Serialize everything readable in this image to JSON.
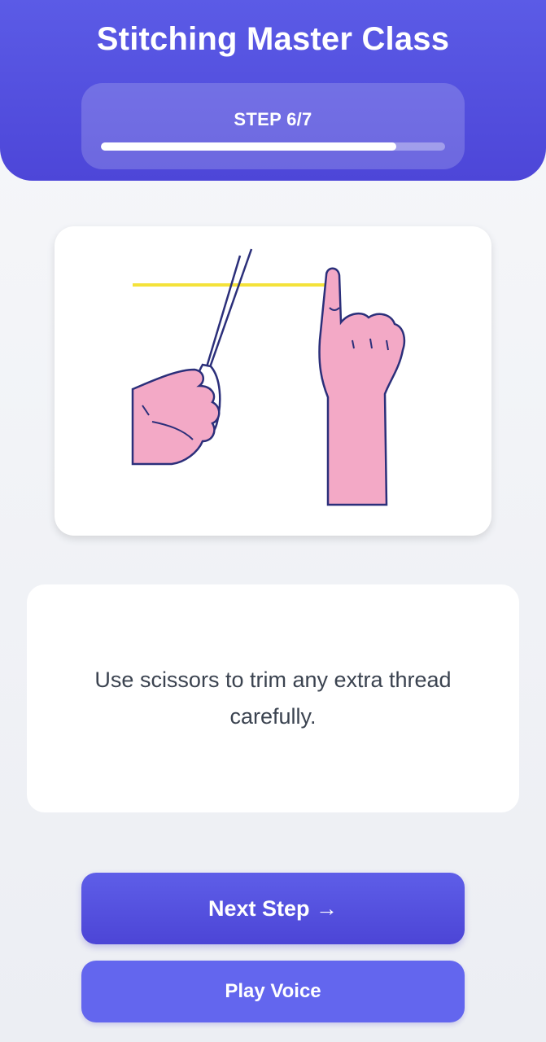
{
  "header": {
    "title": "Stitching Master Class",
    "step_label": "STEP 6/7",
    "progress": 0.857,
    "gradient_top": "#5b5be6",
    "gradient_bottom": "#4d46d8"
  },
  "illustration": {
    "icons": [
      "scissors-icon",
      "hand-icon",
      "pointing-hand-icon",
      "thread-icon"
    ],
    "skin_color": "#f3a9c6",
    "outline_color": "#2b2f7a",
    "thread_color": "#f4e23a"
  },
  "instruction": {
    "text": "Use scissors to trim any extra thread carefully."
  },
  "buttons": {
    "next_label": "Next Step →",
    "voice_label": "Play Voice"
  }
}
